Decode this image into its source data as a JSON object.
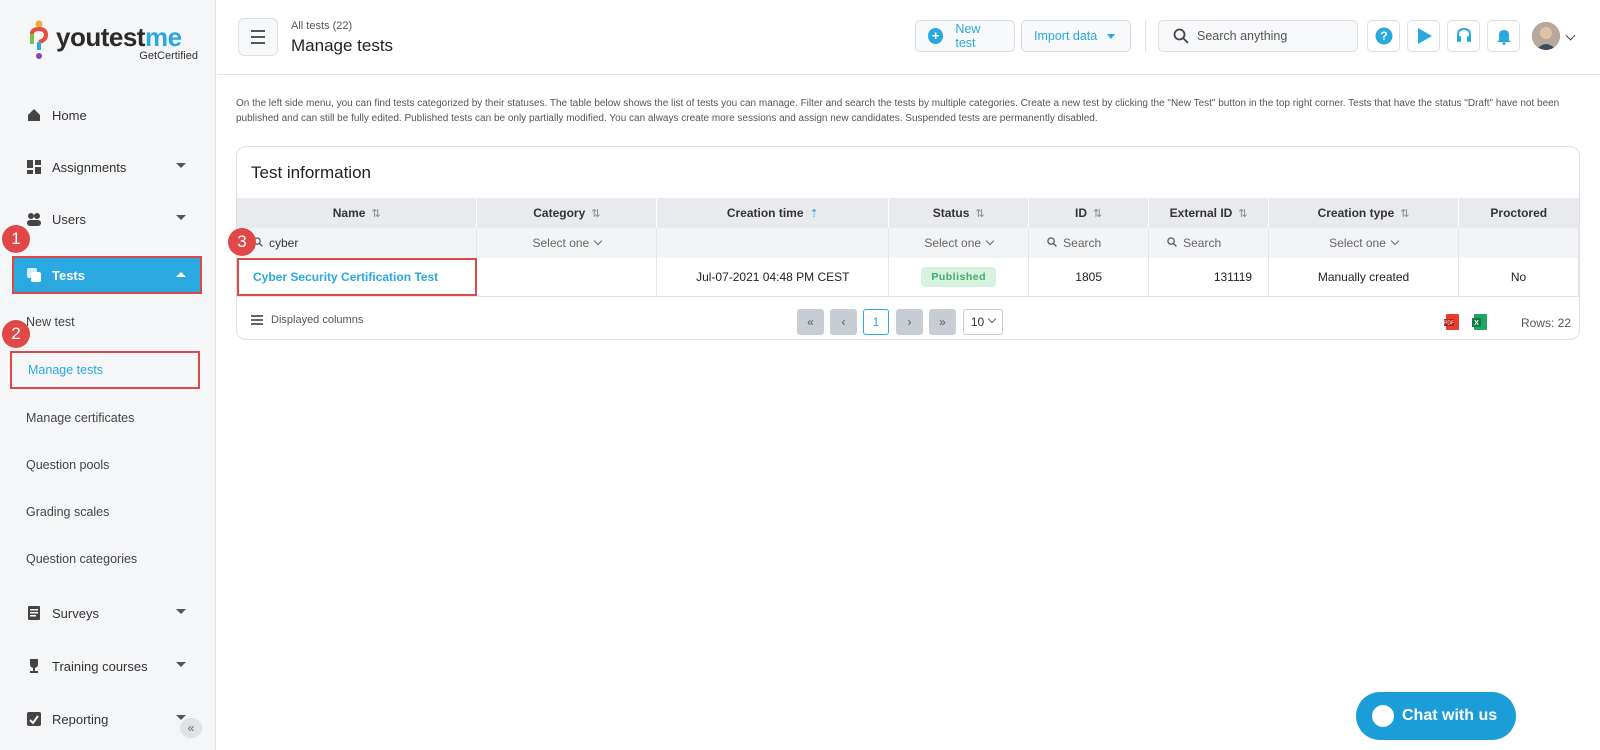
{
  "logo": {
    "name_you": "youtest",
    "name_me": "me",
    "tagline": "GetCertified"
  },
  "sidebar": {
    "items": [
      {
        "label": "Home"
      },
      {
        "label": "Assignments"
      },
      {
        "label": "Users"
      },
      {
        "label": "Tests"
      },
      {
        "label": "Surveys"
      },
      {
        "label": "Training courses"
      },
      {
        "label": "Reporting"
      }
    ],
    "subitems": [
      {
        "label": "New test"
      },
      {
        "label": "Manage tests"
      },
      {
        "label": "Manage certificates"
      },
      {
        "label": "Question pools"
      },
      {
        "label": "Grading scales"
      },
      {
        "label": "Question categories"
      }
    ],
    "collapse_label": "«"
  },
  "badges": [
    "1",
    "2",
    "3"
  ],
  "header": {
    "breadcrumb": "All tests (22)",
    "title": "Manage tests",
    "new_test_label": "New test",
    "import_label": "Import data",
    "search_placeholder": "Search anything"
  },
  "info_text": "On the left side menu, you can find tests categorized by their statuses. The table below shows the list of tests you can manage. Filter and search the tests by multiple categories. Create a new test by clicking the \"New Test\" button in the top right corner. Tests that have the status \"Draft\" have not been published and can still be fully edited. Published tests can be only partially modified. You can always create more sessions and assign new candidates. Suspended tests are permanently disabled.",
  "table": {
    "title": "Test information",
    "columns": [
      "Name",
      "Category",
      "Creation time",
      "Status",
      "ID",
      "External ID",
      "Creation type",
      "Proctored"
    ],
    "filters": {
      "name": "cyber",
      "category": "Select one",
      "status": "Select one",
      "id": "Search",
      "external_id": "Search",
      "creation_type": "Select one"
    },
    "rows": [
      {
        "name": "Cyber Security Certification Test",
        "category": "",
        "creation_time": "Jul-07-2021 04:48 PM CEST",
        "status": "Published",
        "id": "1805",
        "external_id": "131119",
        "creation_type": "Manually created",
        "proctored": "No"
      }
    ],
    "footer": {
      "displayed_columns": "Displayed columns",
      "current_page": "1",
      "page_size": "10",
      "rows_label": "Rows: 22"
    }
  },
  "chat": {
    "label": "Chat with us"
  },
  "colors": {
    "accent": "#2aa8e0",
    "highlight": "#e04848",
    "published": "#3fae64"
  }
}
